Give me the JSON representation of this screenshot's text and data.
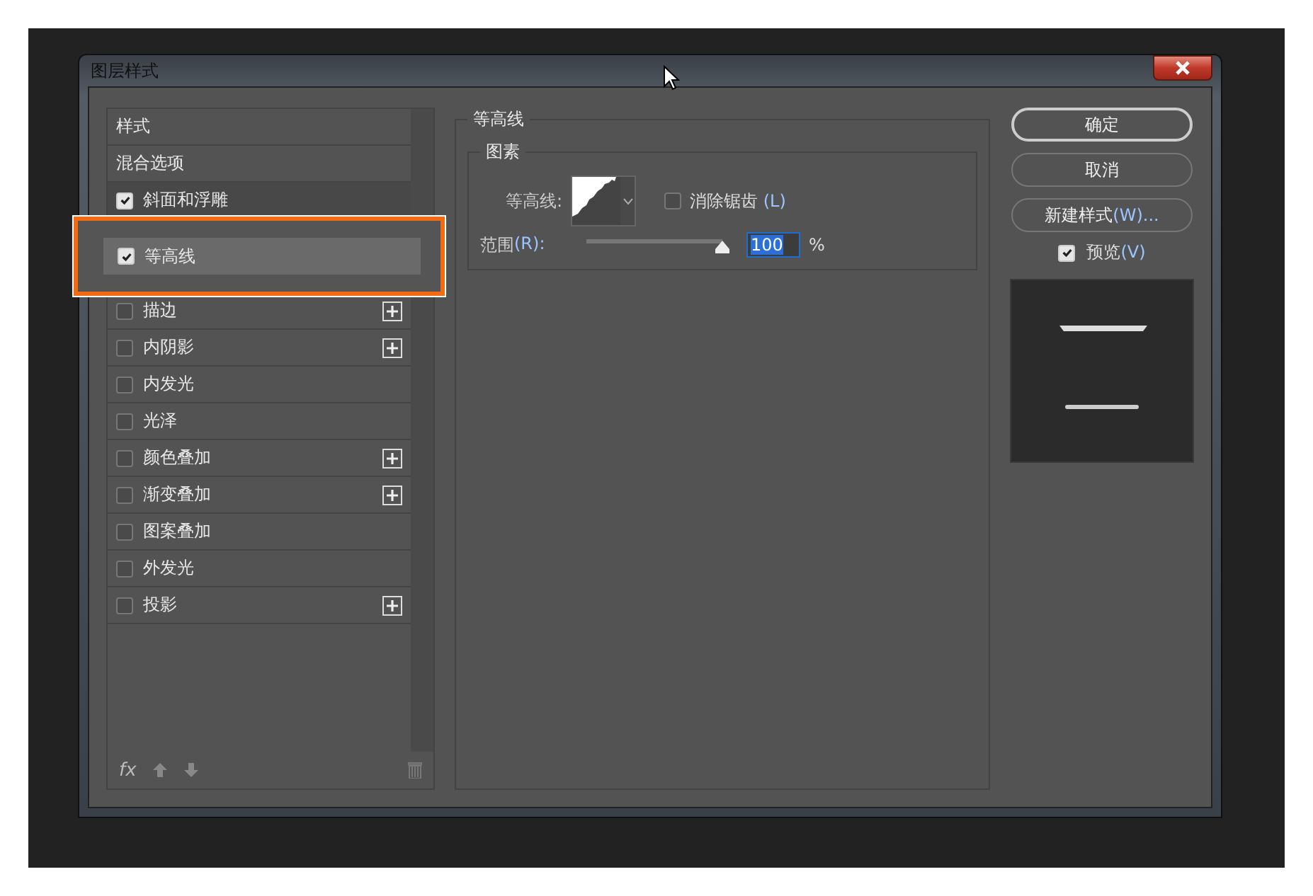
{
  "window": {
    "title": "图层样式"
  },
  "styles_list": {
    "items": [
      {
        "kind": "header",
        "label": "样式",
        "selected": false
      },
      {
        "kind": "header",
        "label": "混合选项",
        "selected": false
      },
      {
        "kind": "check",
        "label": "斜面和浮雕",
        "checked": true,
        "selected": false,
        "addable": false
      },
      {
        "kind": "sub",
        "label": "等高线",
        "checked": true,
        "selected": true,
        "addable": false
      },
      {
        "kind": "check",
        "label": "描边",
        "checked": false,
        "selected": false,
        "addable": true
      },
      {
        "kind": "check",
        "label": "内阴影",
        "checked": false,
        "selected": false,
        "addable": true
      },
      {
        "kind": "check",
        "label": "内发光",
        "checked": false,
        "selected": false,
        "addable": false
      },
      {
        "kind": "check",
        "label": "光泽",
        "checked": false,
        "selected": false,
        "addable": false
      },
      {
        "kind": "check",
        "label": "颜色叠加",
        "checked": false,
        "selected": false,
        "addable": true
      },
      {
        "kind": "check",
        "label": "渐变叠加",
        "checked": false,
        "selected": false,
        "addable": true
      },
      {
        "kind": "check",
        "label": "图案叠加",
        "checked": false,
        "selected": false,
        "addable": false
      },
      {
        "kind": "check",
        "label": "外发光",
        "checked": false,
        "selected": false,
        "addable": false
      },
      {
        "kind": "check",
        "label": "投影",
        "checked": false,
        "selected": false,
        "addable": true
      }
    ],
    "footer": {
      "fx": "fx"
    }
  },
  "contour_group": {
    "title": "等高线",
    "subgroup": "图素",
    "contour_label": "等高线:",
    "antialias": {
      "label": "消除锯齿",
      "shortcut": "(L)",
      "checked": false
    },
    "range": {
      "label": "范围",
      "shortcut": "(R):",
      "level": 1.0,
      "value": "100",
      "unit": "%"
    }
  },
  "buttons": [
    {
      "label": "确定",
      "default": true
    },
    {
      "label": "取消",
      "default": false
    },
    {
      "label": "新建样式",
      "shortcut": "(W)...",
      "default": false
    }
  ],
  "preview": {
    "label": "预览",
    "shortcut": "(V)",
    "checked": true
  }
}
